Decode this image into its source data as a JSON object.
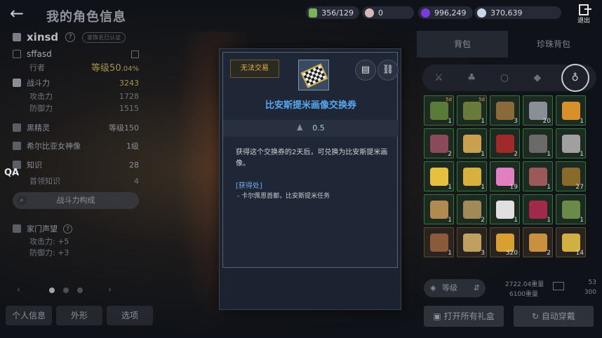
{
  "header": {
    "title": "我的角色信息",
    "back_icon": "arrow-left-icon",
    "exit_label": "退出"
  },
  "currencies": [
    {
      "icon": "energy-icon",
      "color": "#7ab35a",
      "value": "356/129"
    },
    {
      "icon": "pearl-icon",
      "color": "#d8b8b8",
      "value": "0"
    },
    {
      "icon": "purple-gem-icon",
      "color": "#7a3ae0",
      "value": "996,249"
    },
    {
      "icon": "silver-coin-icon",
      "color": "#c8d8e8",
      "value": "370,639"
    }
  ],
  "profile": {
    "family_name": "xinsd",
    "family_tag": "家族名已认证",
    "char_name": "sffasd",
    "class": "行者",
    "level": "等级50",
    "level_pct": ".04%"
  },
  "stats": {
    "combat_label": "战斗力",
    "combat_value": "3243",
    "attack_label": "攻击力",
    "attack_value": "1728",
    "defense_label": "防御力",
    "defense_value": "1515",
    "black_spirit_label": "黑精灵",
    "black_spirit_value": "等级150",
    "goddess_label": "希尔比亚女神像",
    "goddess_value": "1级",
    "knowledge_label": "知识",
    "knowledge_value": "28",
    "lead_knowledge_label": "首领知识",
    "lead_knowledge_value": "4",
    "combat_breakdown_btn": "战斗力构成",
    "fame_label": "家门声望",
    "fame_attack": "攻击力: +5",
    "fame_defense": "防御力: +3"
  },
  "bottom_tabs": [
    "个人信息",
    "外形",
    "选项"
  ],
  "qa_label": "QA",
  "inventory": {
    "tabs": [
      "背包",
      "珍珠背包"
    ],
    "categories": [
      "swords-icon",
      "armor-icon",
      "ring-icon",
      "gem-icon",
      "bag-icon"
    ],
    "slots": [
      {
        "color": "#5a7a3a",
        "count": "1",
        "badge": "5d"
      },
      {
        "color": "#6a7a3a",
        "count": "1",
        "badge": "5d"
      },
      {
        "color": "#8a6a3a",
        "count": "3",
        "badge": ""
      },
      {
        "color": "#8a8e96",
        "count": "20",
        "badge": ""
      },
      {
        "color": "#d8902a",
        "count": "1",
        "badge": ""
      },
      {
        "color": "#8a4a5a",
        "count": "2",
        "badge": ""
      },
      {
        "color": "#c8a050",
        "count": "1",
        "badge": ""
      },
      {
        "color": "#a02a2a",
        "count": "2",
        "badge": ""
      },
      {
        "color": "#6a6a6a",
        "count": "1",
        "badge": ""
      },
      {
        "color": "#a0a0a0",
        "count": "1",
        "badge": ""
      },
      {
        "color": "#e8c040",
        "count": "1",
        "badge": ""
      },
      {
        "color": "#d8b040",
        "count": "1",
        "badge": ""
      },
      {
        "color": "#e080c0",
        "count": "19",
        "badge": ""
      },
      {
        "color": "#9a5a5a",
        "count": "1",
        "badge": ""
      },
      {
        "color": "#8a6a2a",
        "count": "27",
        "badge": ""
      },
      {
        "color": "#b08a50",
        "count": "1",
        "badge": ""
      },
      {
        "color": "#a08a5a",
        "count": "2",
        "badge": ""
      },
      {
        "color": "#e0e0e0",
        "count": "1",
        "badge": ""
      },
      {
        "color": "#a02a4a",
        "count": "1",
        "badge": ""
      },
      {
        "color": "#6a8a4a",
        "count": "1",
        "badge": ""
      },
      {
        "color": "#8a5a3a",
        "count": "1",
        "badge": ""
      },
      {
        "color": "#c0a060",
        "count": "3",
        "badge": ""
      },
      {
        "color": "#d8a030",
        "count": "320",
        "badge": ""
      },
      {
        "color": "#c89040",
        "count": "2",
        "badge": ""
      },
      {
        "color": "#d0b040",
        "count": "14",
        "badge": ""
      }
    ],
    "sort_label": "等级",
    "weight_current": "2722.04重量",
    "weight_max": "6100重量",
    "slots_used": "53",
    "slots_total": "300",
    "open_all_btn": "打开所有礼盒",
    "auto_equip_btn": "自动穿戴"
  },
  "tooltip": {
    "trade_badge": "无法交易",
    "item_name": "比安斯提米画像交换券",
    "weight": "0.5",
    "description": "获得这个交换券的2天后，可兑换为比安斯提米画像。",
    "source_title": "[获得处]",
    "source_text": "- 卡尔佩恩首都，比安斯提米任务",
    "book_icon": "book-icon",
    "link_icon": "link-icon"
  }
}
